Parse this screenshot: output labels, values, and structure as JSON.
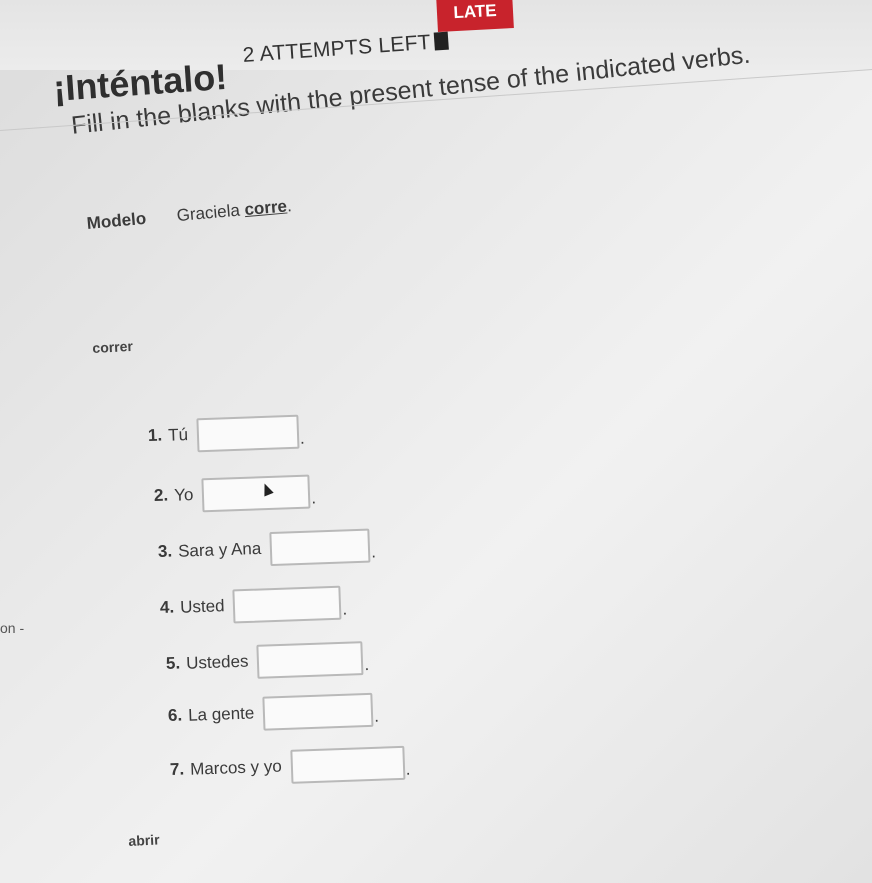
{
  "header": {
    "title": "¡Inténtalo!",
    "attempts": "2 ATTEMPTS LEFT",
    "status_badge": "LATE"
  },
  "instructions": "Fill in the blanks with the present tense of the indicated verbs.",
  "modelo": {
    "label": "Modelo",
    "sentence_before": "Graciela ",
    "answer": "corre",
    "sentence_after": "."
  },
  "sections": [
    {
      "verb": "correr",
      "items": [
        {
          "num": "1.",
          "subject": "Tú",
          "value": "",
          "end": "."
        },
        {
          "num": "2.",
          "subject": "Yo",
          "value": "",
          "end": "."
        },
        {
          "num": "3.",
          "subject": "Sara y Ana",
          "value": "",
          "end": "."
        },
        {
          "num": "4.",
          "subject": "Usted",
          "value": "",
          "end": "."
        },
        {
          "num": "5.",
          "subject": "Ustedes",
          "value": "",
          "end": "."
        },
        {
          "num": "6.",
          "subject": "La gente",
          "value": "",
          "end": "."
        },
        {
          "num": "7.",
          "subject": "Marcos y yo",
          "value": "",
          "end": "."
        }
      ]
    },
    {
      "verb": "abrir",
      "items": []
    }
  ],
  "side_text": "on -"
}
